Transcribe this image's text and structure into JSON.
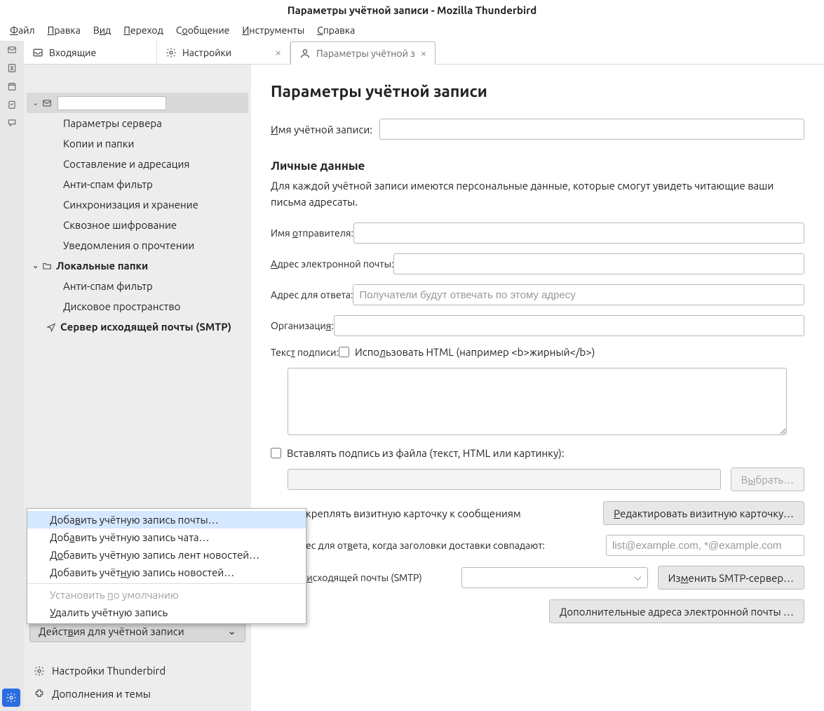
{
  "title": "Параметры учётной записи - Mozilla Thunderbird",
  "menu": [
    "Файл",
    "Правка",
    "Вид",
    "Переход",
    "Сообщение",
    "Инструменты",
    "Справка"
  ],
  "menu_ul": [
    0,
    0,
    0,
    0,
    0,
    0,
    0
  ],
  "tabs": {
    "t0": "Входящие",
    "t1": "Настройки",
    "t2": "Параметры учётной з"
  },
  "tree": {
    "server_params": "Параметры сервера",
    "copies": "Копии и папки",
    "compose": "Составление и адресация",
    "spam1": "Анти-спам фильтр",
    "sync": "Синхронизация и хранение",
    "e2e": "Сквозное шифрование",
    "receipts": "Уведомления о прочтении",
    "local": "Локальные папки",
    "spam2": "Анти-спам фильтр",
    "disk": "Дисковое пространство",
    "smtp": "Сервер исходящей почты (SMTP)"
  },
  "actions_btn": "Действия для учётной записи",
  "links": {
    "tb_settings": "Настройки Thunderbird",
    "addons": "Дополнения и темы"
  },
  "popup": {
    "add_mail": "Добавить учётную запись почты…",
    "add_chat": "Добавить учётную запись чата…",
    "add_feed": "Добавить учётную запись лент новостей…",
    "add_news": "Добавить учётную запись новостей…",
    "set_default": "Установить по умолчанию",
    "delete": "Удалить учётную запись"
  },
  "pane": {
    "heading": "Параметры учётной записи",
    "acct_name_label": "Имя учётной записи:",
    "personal_heading": "Личные данные",
    "personal_desc": "Для каждой учётной записи имеются персональные данные, которые смогут увидеть читающие ваши письма адресаты.",
    "sender_name": "Имя отправителя:",
    "email": "Адрес электронной почты:",
    "reply": "Адрес для ответа:",
    "reply_placeholder": "Получатели будут отвечать по этому адресу",
    "org": "Организация:",
    "sig_text": "Текст подписи:",
    "sig_html": "Использовать HTML (например <b>жирный</b>)",
    "sig_file": "Вставлять подпись из файла (текст, HTML или картинку):",
    "browse": "Выбрать…",
    "vcard_attach": "Прикреплять визитную карточку к сообщениям",
    "vcard_edit": "Редактировать визитную карточку…",
    "reply_match_pre": "ес для ответа, когда заголовки доставки совпадают:",
    "reply_match_placeholder": "list@example.com, *@example.com",
    "smtp_label": "Сервер исходящей почты (SMTP)",
    "smtp_edit": "Изменить SMTP-сервер…",
    "more_addrs": "Дополнительные адреса электронной почты …"
  }
}
